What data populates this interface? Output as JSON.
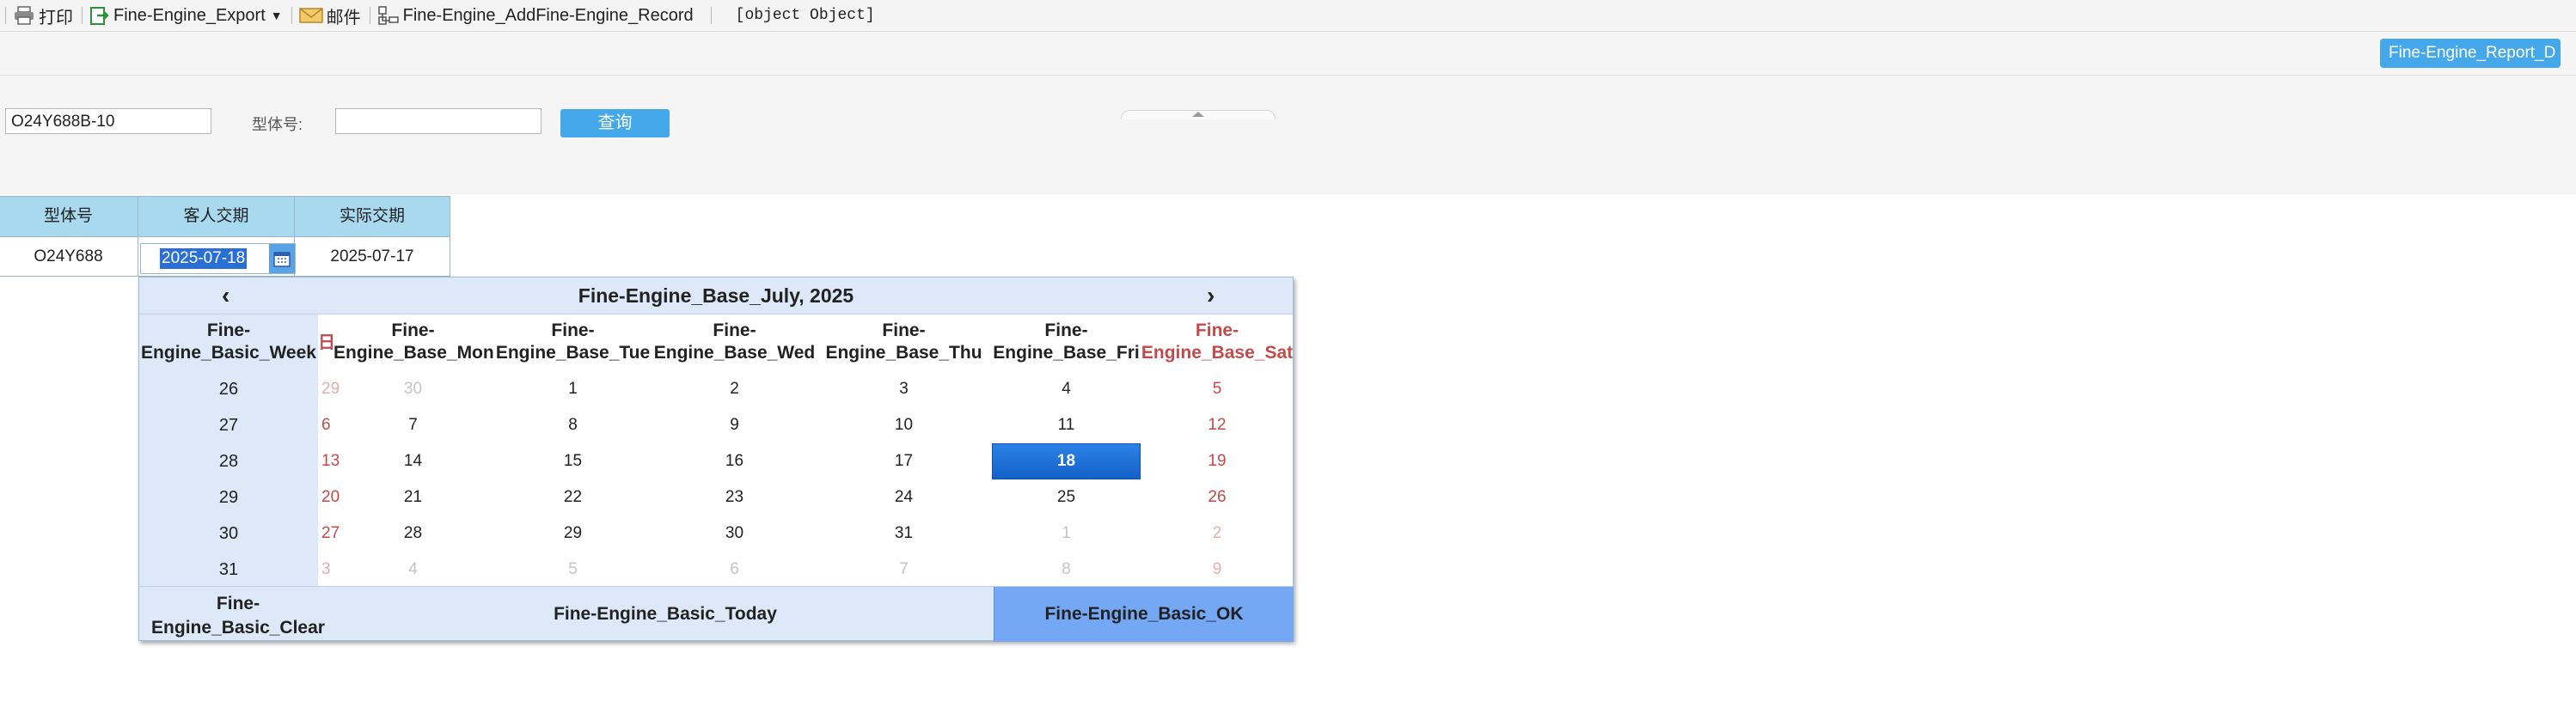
{
  "toolbar": {
    "print_label": "打印",
    "export_label": "Fine-Engine_Export",
    "mail_label": "邮件",
    "add_record_label": "Fine-Engine_AddFine-Engine_Record",
    "object_text": "[object Object]"
  },
  "report_button_label": "Fine-Engine_Report_D",
  "params": {
    "field1_value": "O24Y688B-10",
    "model_label": "型体号:",
    "model_value": "",
    "query_label": "查询"
  },
  "table": {
    "headers": [
      "型体号",
      "客人交期",
      "实际交期"
    ],
    "rows": [
      [
        "O24Y688",
        "2025-07-18",
        "2025-07-17"
      ]
    ]
  },
  "calendar": {
    "title": "Fine-Engine_Base_July, 2025",
    "prev": "‹",
    "next": "›",
    "week_header": "Fine-Engine_Basic_Week",
    "weekday_headers": [
      "日",
      "Fine-Engine_Base_Mon",
      "Fine-Engine_Base_Tue",
      "Fine-Engine_Base_Wed",
      "Fine-Engine_Base_Thu",
      "Fine-Engine_Base_Fri",
      "Fine-Engine_Base_Sat"
    ],
    "weeks": [
      {
        "week": "26",
        "days": [
          "29",
          "30",
          "1",
          "2",
          "3",
          "4",
          "5"
        ]
      },
      {
        "week": "27",
        "days": [
          "6",
          "7",
          "8",
          "9",
          "10",
          "11",
          "12"
        ]
      },
      {
        "week": "28",
        "days": [
          "13",
          "14",
          "15",
          "16",
          "17",
          "18",
          "19"
        ]
      },
      {
        "week": "29",
        "days": [
          "20",
          "21",
          "22",
          "23",
          "24",
          "25",
          "26"
        ]
      },
      {
        "week": "30",
        "days": [
          "27",
          "28",
          "29",
          "30",
          "31",
          "1",
          "2"
        ]
      },
      {
        "week": "31",
        "days": [
          "3",
          "4",
          "5",
          "6",
          "7",
          "8",
          "9"
        ]
      }
    ],
    "selected_day": "18",
    "clear_label": "Fine-Engine_Basic_Clear",
    "today_label": "Fine-Engine_Basic_Today",
    "ok_label": "Fine-Engine_Basic_OK",
    "colors": {
      "weekend": "#c44a4a",
      "selected": "#1e6fd9",
      "ok_bg": "#74a8f5",
      "popup_bg": "#dde9f8"
    }
  }
}
